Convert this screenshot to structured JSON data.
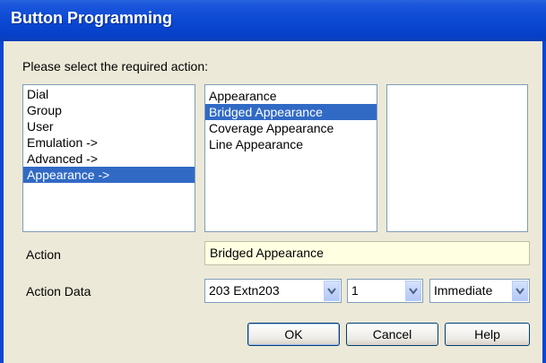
{
  "window": {
    "title": "Button Programming"
  },
  "prompt": "Please select the required action:",
  "list1": {
    "items": [
      "Dial",
      "Group",
      "User",
      "Emulation ->",
      "Advanced ->",
      "Appearance ->"
    ],
    "selected": "Appearance ->"
  },
  "list2": {
    "items": [
      "Appearance",
      "Bridged Appearance",
      "Coverage Appearance",
      "Line Appearance"
    ],
    "selected": "Bridged Appearance"
  },
  "list3": {
    "items": []
  },
  "action": {
    "label": "Action",
    "value": "Bridged Appearance"
  },
  "action_data": {
    "label": "Action Data",
    "combo1": "203 Extn203",
    "combo2": "1",
    "combo3": "Immediate"
  },
  "buttons": {
    "ok": "OK",
    "cancel": "Cancel",
    "help": "Help"
  },
  "colors": {
    "title_bar": "#0a47d2",
    "selection": "#316ac5",
    "action_field_bg": "#ffffe1"
  }
}
